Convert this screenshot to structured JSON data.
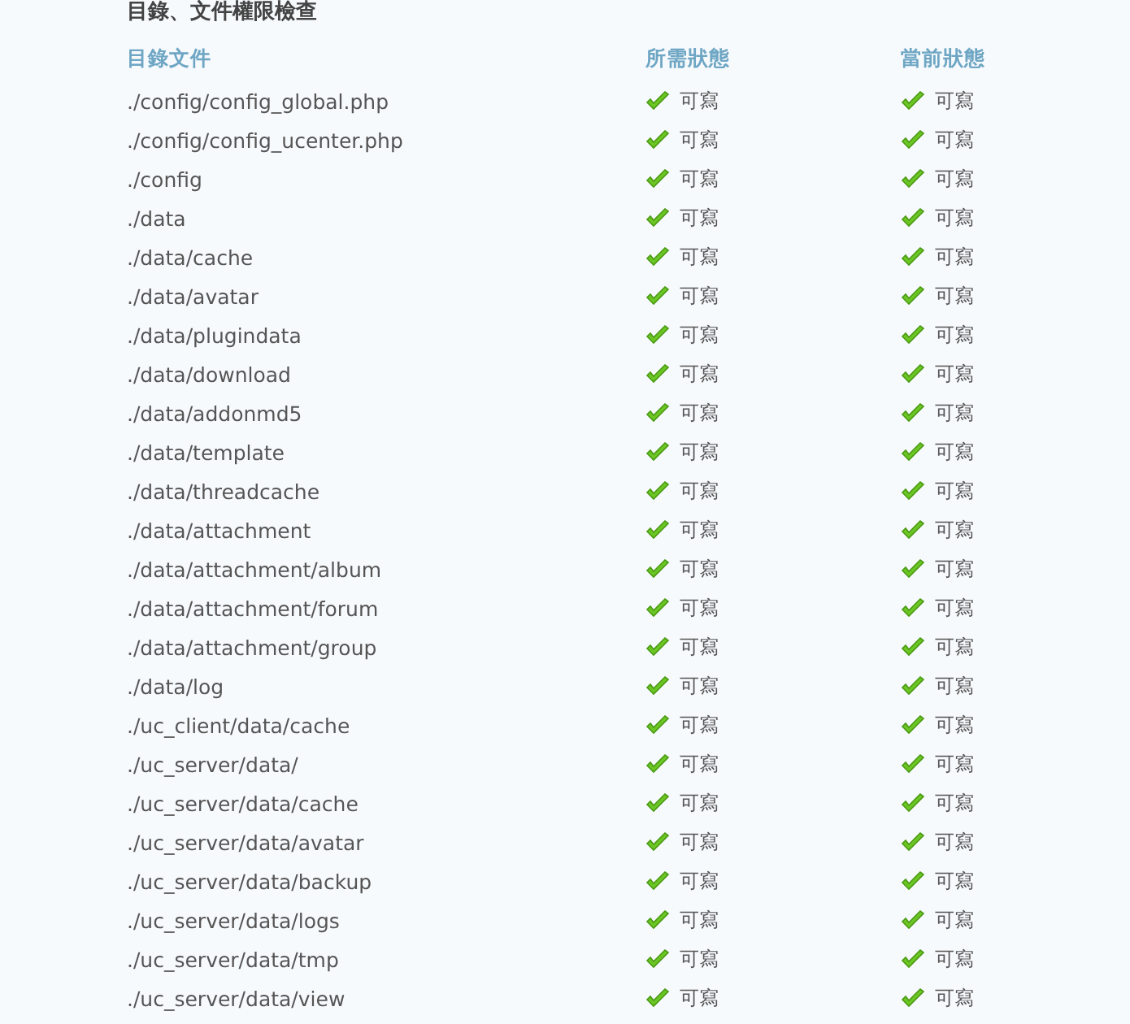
{
  "title": "目錄、文件權限檢查",
  "columns": [
    "目錄文件",
    "所需狀態",
    "當前狀態"
  ],
  "rows": [
    {
      "path": "./config/config_global.php",
      "required": {
        "ok": true,
        "text": "可寫"
      },
      "current": {
        "ok": true,
        "text": "可寫"
      }
    },
    {
      "path": "./config/config_ucenter.php",
      "required": {
        "ok": true,
        "text": "可寫"
      },
      "current": {
        "ok": true,
        "text": "可寫"
      }
    },
    {
      "path": "./config",
      "required": {
        "ok": true,
        "text": "可寫"
      },
      "current": {
        "ok": true,
        "text": "可寫"
      }
    },
    {
      "path": "./data",
      "required": {
        "ok": true,
        "text": "可寫"
      },
      "current": {
        "ok": true,
        "text": "可寫"
      }
    },
    {
      "path": "./data/cache",
      "required": {
        "ok": true,
        "text": "可寫"
      },
      "current": {
        "ok": true,
        "text": "可寫"
      }
    },
    {
      "path": "./data/avatar",
      "required": {
        "ok": true,
        "text": "可寫"
      },
      "current": {
        "ok": true,
        "text": "可寫"
      }
    },
    {
      "path": "./data/plugindata",
      "required": {
        "ok": true,
        "text": "可寫"
      },
      "current": {
        "ok": true,
        "text": "可寫"
      }
    },
    {
      "path": "./data/download",
      "required": {
        "ok": true,
        "text": "可寫"
      },
      "current": {
        "ok": true,
        "text": "可寫"
      }
    },
    {
      "path": "./data/addonmd5",
      "required": {
        "ok": true,
        "text": "可寫"
      },
      "current": {
        "ok": true,
        "text": "可寫"
      }
    },
    {
      "path": "./data/template",
      "required": {
        "ok": true,
        "text": "可寫"
      },
      "current": {
        "ok": true,
        "text": "可寫"
      }
    },
    {
      "path": "./data/threadcache",
      "required": {
        "ok": true,
        "text": "可寫"
      },
      "current": {
        "ok": true,
        "text": "可寫"
      }
    },
    {
      "path": "./data/attachment",
      "required": {
        "ok": true,
        "text": "可寫"
      },
      "current": {
        "ok": true,
        "text": "可寫"
      }
    },
    {
      "path": "./data/attachment/album",
      "required": {
        "ok": true,
        "text": "可寫"
      },
      "current": {
        "ok": true,
        "text": "可寫"
      }
    },
    {
      "path": "./data/attachment/forum",
      "required": {
        "ok": true,
        "text": "可寫"
      },
      "current": {
        "ok": true,
        "text": "可寫"
      }
    },
    {
      "path": "./data/attachment/group",
      "required": {
        "ok": true,
        "text": "可寫"
      },
      "current": {
        "ok": true,
        "text": "可寫"
      }
    },
    {
      "path": "./data/log",
      "required": {
        "ok": true,
        "text": "可寫"
      },
      "current": {
        "ok": true,
        "text": "可寫"
      }
    },
    {
      "path": "./uc_client/data/cache",
      "required": {
        "ok": true,
        "text": "可寫"
      },
      "current": {
        "ok": true,
        "text": "可寫"
      }
    },
    {
      "path": "./uc_server/data/",
      "required": {
        "ok": true,
        "text": "可寫"
      },
      "current": {
        "ok": true,
        "text": "可寫"
      }
    },
    {
      "path": "./uc_server/data/cache",
      "required": {
        "ok": true,
        "text": "可寫"
      },
      "current": {
        "ok": true,
        "text": "可寫"
      }
    },
    {
      "path": "./uc_server/data/avatar",
      "required": {
        "ok": true,
        "text": "可寫"
      },
      "current": {
        "ok": true,
        "text": "可寫"
      }
    },
    {
      "path": "./uc_server/data/backup",
      "required": {
        "ok": true,
        "text": "可寫"
      },
      "current": {
        "ok": true,
        "text": "可寫"
      }
    },
    {
      "path": "./uc_server/data/logs",
      "required": {
        "ok": true,
        "text": "可寫"
      },
      "current": {
        "ok": true,
        "text": "可寫"
      }
    },
    {
      "path": "./uc_server/data/tmp",
      "required": {
        "ok": true,
        "text": "可寫"
      },
      "current": {
        "ok": true,
        "text": "可寫"
      }
    },
    {
      "path": "./uc_server/data/view",
      "required": {
        "ok": true,
        "text": "可寫"
      },
      "current": {
        "ok": true,
        "text": "可寫"
      }
    }
  ]
}
